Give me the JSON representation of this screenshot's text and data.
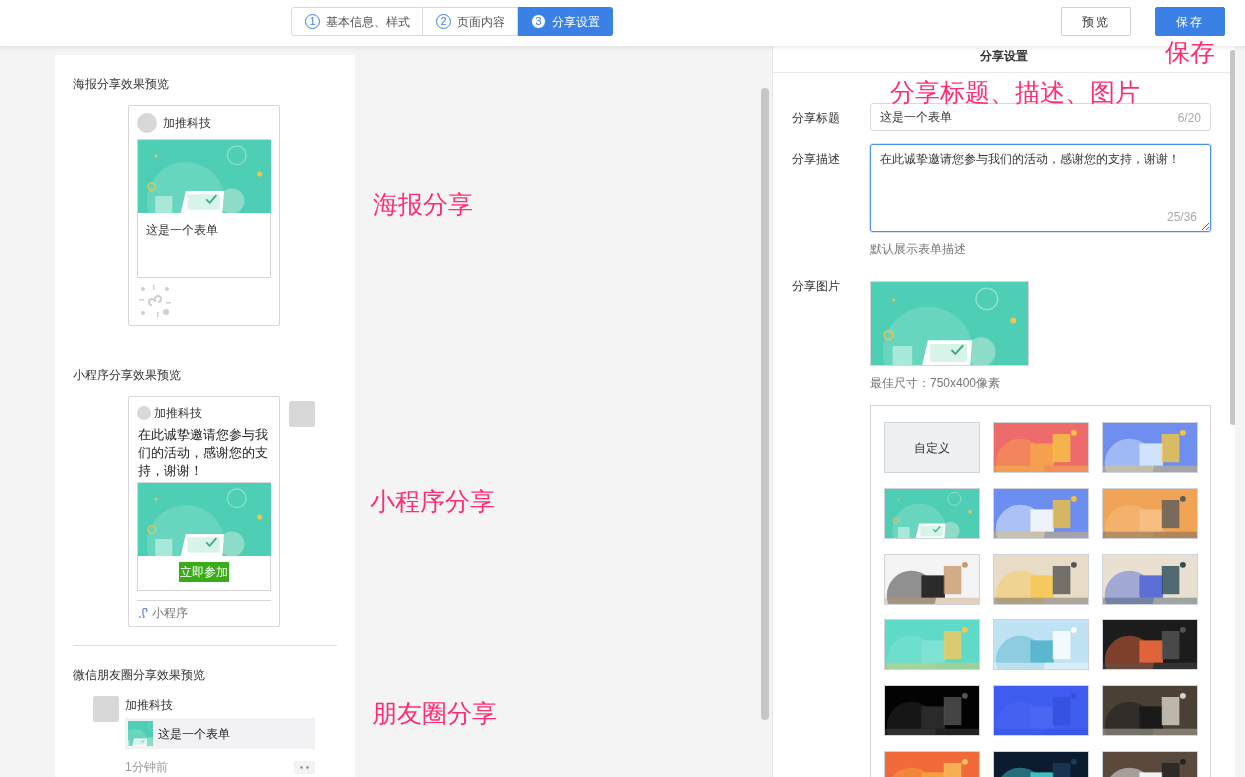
{
  "steps": [
    {
      "number": "1",
      "label": "基本信息、样式",
      "selected": false
    },
    {
      "number": "2",
      "label": "页面内容",
      "selected": false
    },
    {
      "number": "3",
      "label": "分享设置",
      "selected": true
    }
  ],
  "actions": [
    {
      "label": "预览",
      "kind": "secondary"
    },
    {
      "label": "保存",
      "kind": "primary"
    }
  ],
  "poster_preview": {
    "heading": "海报分享效果预览",
    "account": "加推科技",
    "form_title": "这是一个表单"
  },
  "mini_program_preview": {
    "heading": "小程序分享效果预览",
    "account": "加推科技",
    "description": "在此诚挚邀请您参与我们的活动，感谢您的支持，谢谢！",
    "button": "立即参加",
    "footer": "小程序"
  },
  "moments_preview": {
    "heading": "微信朋友圈分享效果预览",
    "account": "加推科技",
    "link_title": "这是一个表单",
    "time": "1分钟前"
  },
  "settings": {
    "title": "分享设置",
    "share_title": {
      "label": "分享标题",
      "value": "这是一个表单",
      "counter": "6/20"
    },
    "share_description": {
      "label": "分享描述",
      "value": "在此诚挚邀请您参与我们的活动，感谢您的支持，谢谢！",
      "counter": "25/36",
      "hint": "默认展示表单描述",
      "focused": true
    },
    "share_image": {
      "label": "分享图片",
      "hint": "最佳尺寸：750x400像素"
    },
    "templates": [
      {
        "kind": "custom",
        "label": "自定义"
      },
      {
        "kind": "picture"
      },
      {
        "kind": "picture"
      },
      {
        "kind": "picture"
      },
      {
        "kind": "picture"
      },
      {
        "kind": "picture"
      },
      {
        "kind": "picture"
      },
      {
        "kind": "picture"
      },
      {
        "kind": "picture"
      },
      {
        "kind": "picture"
      },
      {
        "kind": "picture"
      },
      {
        "kind": "picture"
      },
      {
        "kind": "picture"
      },
      {
        "kind": "picture"
      },
      {
        "kind": "picture"
      },
      {
        "kind": "picture"
      },
      {
        "kind": "picture"
      },
      {
        "kind": "picture"
      }
    ]
  },
  "annotations": [
    {
      "text": "保存"
    },
    {
      "text": "分享标题、描述、图片"
    },
    {
      "text": "海报分享"
    },
    {
      "text": "小程序分享"
    },
    {
      "text": "朋友圈分享"
    }
  ]
}
